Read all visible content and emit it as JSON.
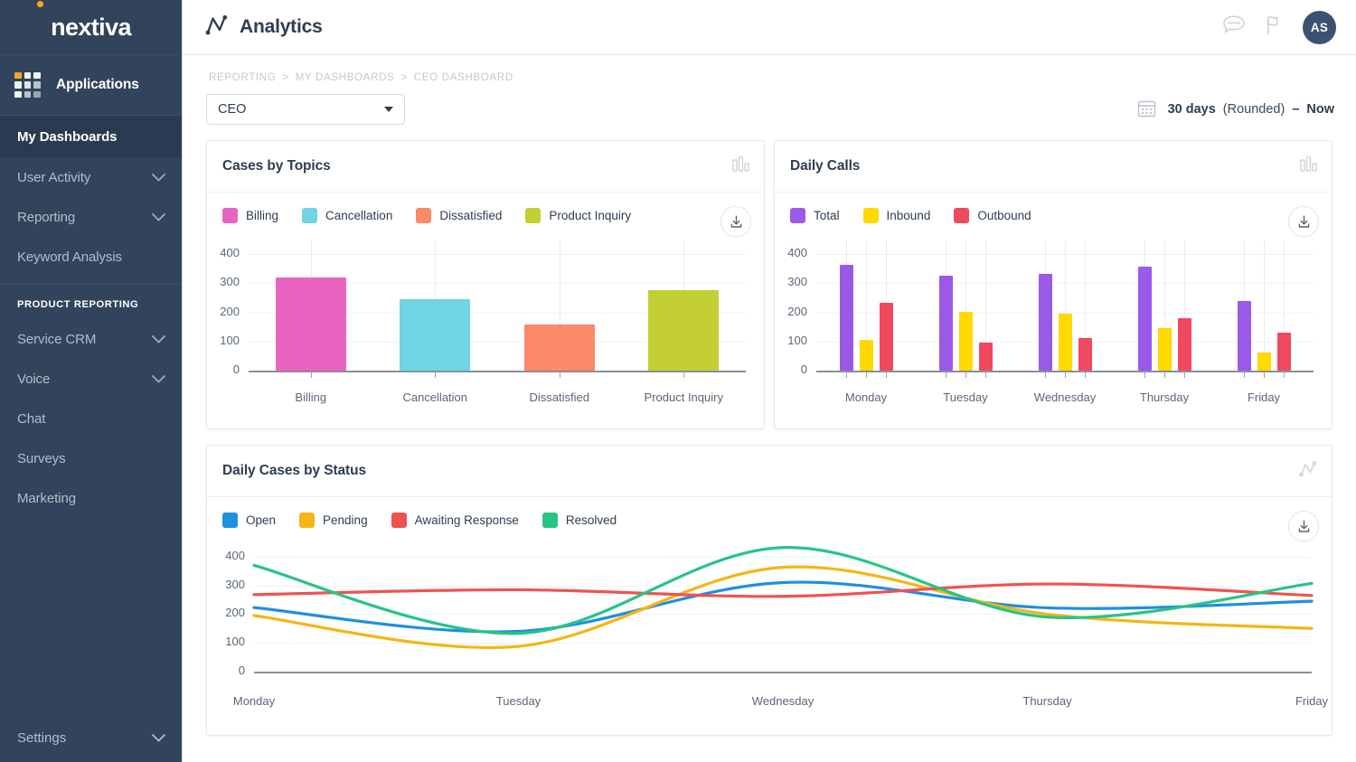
{
  "sidebar": {
    "brand": "nextiva",
    "applications_label": "Applications",
    "applications_icon": "grid-apps-icon",
    "items": [
      {
        "label": "My Dashboards",
        "active": true,
        "chevron": false
      },
      {
        "label": "User Activity",
        "active": false,
        "chevron": true
      },
      {
        "label": "Reporting",
        "active": false,
        "chevron": true
      },
      {
        "label": "Keyword Analysis",
        "active": false,
        "chevron": false
      }
    ],
    "section_heading": "PRODUCT REPORTING",
    "product_items": [
      {
        "label": "Service CRM",
        "chevron": true
      },
      {
        "label": "Voice",
        "chevron": true
      },
      {
        "label": "Chat",
        "chevron": false
      },
      {
        "label": "Surveys",
        "chevron": false
      },
      {
        "label": "Marketing",
        "chevron": false
      }
    ],
    "settings": {
      "label": "Settings",
      "chevron": true
    }
  },
  "header": {
    "title": "Analytics",
    "logo_icon": "analytics-line-icon",
    "icons": [
      {
        "name": "chat-bubble-icon"
      },
      {
        "name": "flag-icon"
      }
    ],
    "avatar_initials": "AS"
  },
  "breadcrumb": {
    "items": [
      "REPORTING",
      "MY DASHBOARDS",
      "CEO DASHBOARD"
    ],
    "separator": ">"
  },
  "toolbar": {
    "dashboard_select_value": "CEO",
    "calendar_icon": "calendar-icon",
    "date_range_days": "30 days",
    "date_range_rounded": "(Rounded)",
    "date_range_dash": "–",
    "date_range_end": "Now"
  },
  "cards": {
    "cases_by_topics": {
      "title": "Cases by Topics",
      "type_icon": "bar-chart-icon",
      "download_icon": "download-icon"
    },
    "daily_calls": {
      "title": "Daily Calls",
      "type_icon": "bar-chart-icon",
      "download_icon": "download-icon"
    },
    "daily_cases_by_status": {
      "title": "Daily Cases by Status",
      "type_icon": "line-chart-icon",
      "download_icon": "download-icon"
    }
  },
  "colors": {
    "sidebar_bg": "#32445c",
    "sidebar_active_bg": "#2a3b51",
    "brand_accent": "#f5a623",
    "avatar_bg": "#3b5171",
    "billing": "#e964c0",
    "cancellation": "#6fd4e3",
    "dissatisfied": "#fb8a68",
    "product_inquiry": "#c3cf32",
    "total": "#9b59e8",
    "inbound": "#ffd900",
    "outbound": "#f0485f",
    "open": "#1f8fe0",
    "pending": "#f5b513",
    "awaiting_response": "#ef5350",
    "resolved": "#28c485"
  },
  "chart_data": [
    {
      "id": "cases-by-topics",
      "type": "bar",
      "title": "Cases by Topics",
      "xlabel": "",
      "ylabel": "",
      "ylim": [
        0,
        450
      ],
      "yticks": [
        0,
        100,
        200,
        300,
        400
      ],
      "grid": true,
      "legend_position": "top-left",
      "categories": [
        "Billing",
        "Cancellation",
        "Dissatisfied",
        "Product Inquiry"
      ],
      "legend": [
        "Billing",
        "Cancellation",
        "Dissatisfied",
        "Product Inquiry"
      ],
      "colors": [
        "#e964c0",
        "#6fd4e3",
        "#fb8a68",
        "#c3cf32"
      ],
      "values": [
        320,
        245,
        158,
        277
      ]
    },
    {
      "id": "daily-calls",
      "type": "bar",
      "title": "Daily Calls",
      "xlabel": "",
      "ylabel": "",
      "ylim": [
        0,
        450
      ],
      "yticks": [
        0,
        100,
        200,
        300,
        400
      ],
      "grid": true,
      "legend_position": "top-left",
      "categories": [
        "Monday",
        "Tuesday",
        "Wednesday",
        "Thursday",
        "Friday"
      ],
      "legend": [
        "Total",
        "Inbound",
        "Outbound"
      ],
      "colors": [
        "#9b59e8",
        "#ffd900",
        "#f0485f"
      ],
      "series": [
        {
          "name": "Total",
          "values": [
            363,
            325,
            331,
            357,
            238
          ]
        },
        {
          "name": "Inbound",
          "values": [
            106,
            202,
            195,
            147,
            62
          ]
        },
        {
          "name": "Outbound",
          "values": [
            234,
            96,
            112,
            179,
            131
          ]
        }
      ]
    },
    {
      "id": "daily-cases-by-status",
      "type": "line",
      "title": "Daily Cases by Status",
      "xlabel": "",
      "ylabel": "",
      "ylim": [
        0,
        450
      ],
      "yticks": [
        0,
        100,
        200,
        300,
        400
      ],
      "grid": true,
      "legend_position": "top-left",
      "x": [
        "Monday",
        "Tuesday",
        "Wednesday",
        "Thursday",
        "Friday"
      ],
      "legend": [
        "Open",
        "Pending",
        "Awaiting Response",
        "Resolved"
      ],
      "colors": [
        "#1f8fe0",
        "#f5b513",
        "#ef5350",
        "#28c485"
      ],
      "series": [
        {
          "name": "Open",
          "values": [
            223,
            140,
            310,
            222,
            245
          ]
        },
        {
          "name": "Pending",
          "values": [
            195,
            88,
            363,
            200,
            150
          ]
        },
        {
          "name": "Awaiting Response",
          "values": [
            268,
            285,
            262,
            305,
            265
          ]
        },
        {
          "name": "Resolved",
          "values": [
            370,
            133,
            432,
            190,
            307
          ]
        }
      ]
    }
  ]
}
